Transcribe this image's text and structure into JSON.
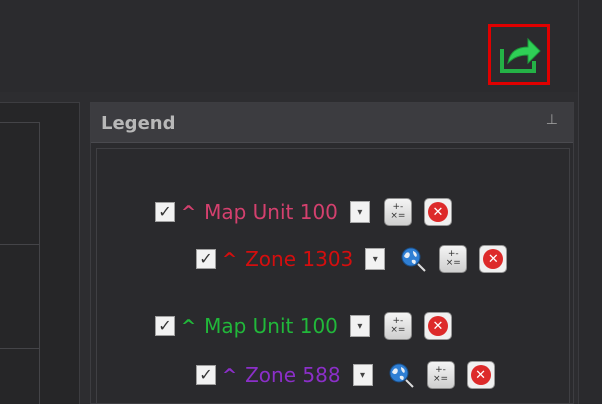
{
  "legend": {
    "title": "Legend",
    "pin_icon": "pin-icon",
    "rows": [
      {
        "label": "Map Unit 100",
        "color": "#d4406e",
        "checked": "✓"
      },
      {
        "label": "Zone 1303",
        "color": "#d40e0e",
        "checked": "✓"
      },
      {
        "label": "Map Unit 100",
        "color": "#21b83a",
        "checked": "✓"
      },
      {
        "label": "Zone 588",
        "color": "#8b2fc8",
        "checked": "✓"
      }
    ]
  },
  "toolbar": {
    "export_icon": "share-export-icon"
  },
  "icons": {
    "caret": "^",
    "dropdown": "▾",
    "close": "✕"
  }
}
